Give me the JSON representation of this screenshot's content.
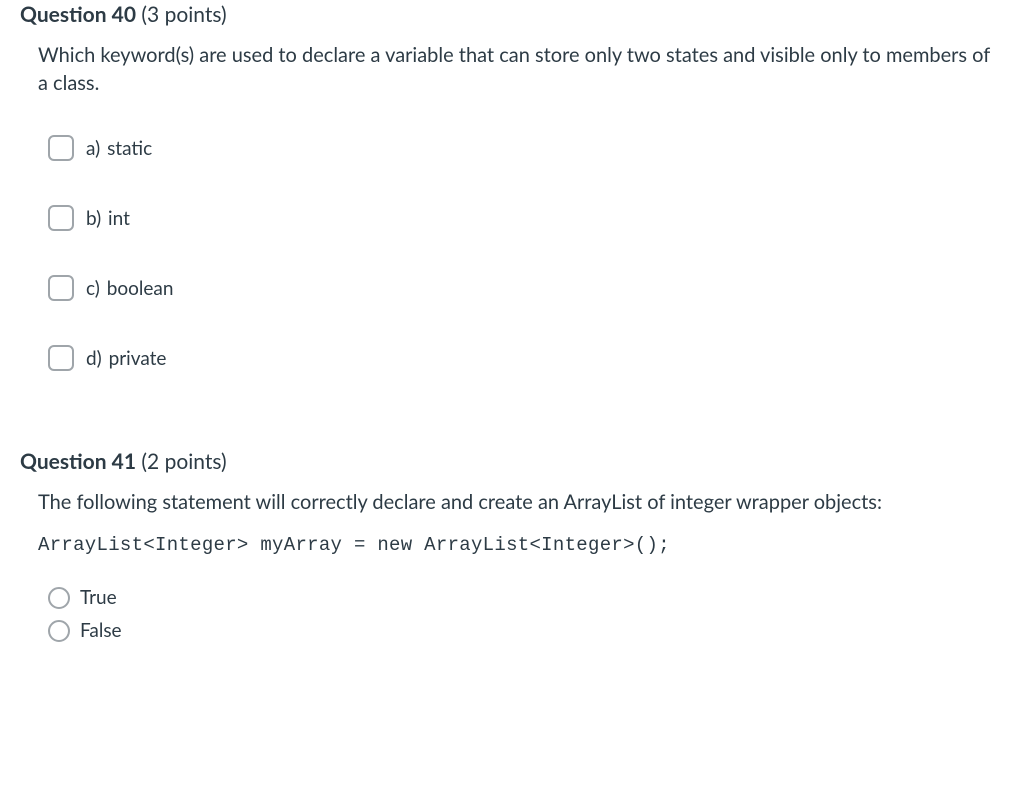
{
  "q40": {
    "label": "Question",
    "number": "40",
    "points": "(3 points)",
    "text": "Which keyword(s) are used to declare a variable that can store only two states and visible only to members of a class.",
    "options": [
      {
        "prefix": "a)",
        "text": "static"
      },
      {
        "prefix": "b)",
        "text": "int"
      },
      {
        "prefix": "c)",
        "text": "boolean"
      },
      {
        "prefix": "d)",
        "text": "private"
      }
    ]
  },
  "q41": {
    "label": "Question",
    "number": "41",
    "points": "(2 points)",
    "text": "The following statement will correctly declare and create an ArrayList of integer wrapper objects:",
    "code": "ArrayList<Integer> myArray = new ArrayList<Integer>();",
    "options": [
      {
        "text": "True"
      },
      {
        "text": "False"
      }
    ]
  }
}
